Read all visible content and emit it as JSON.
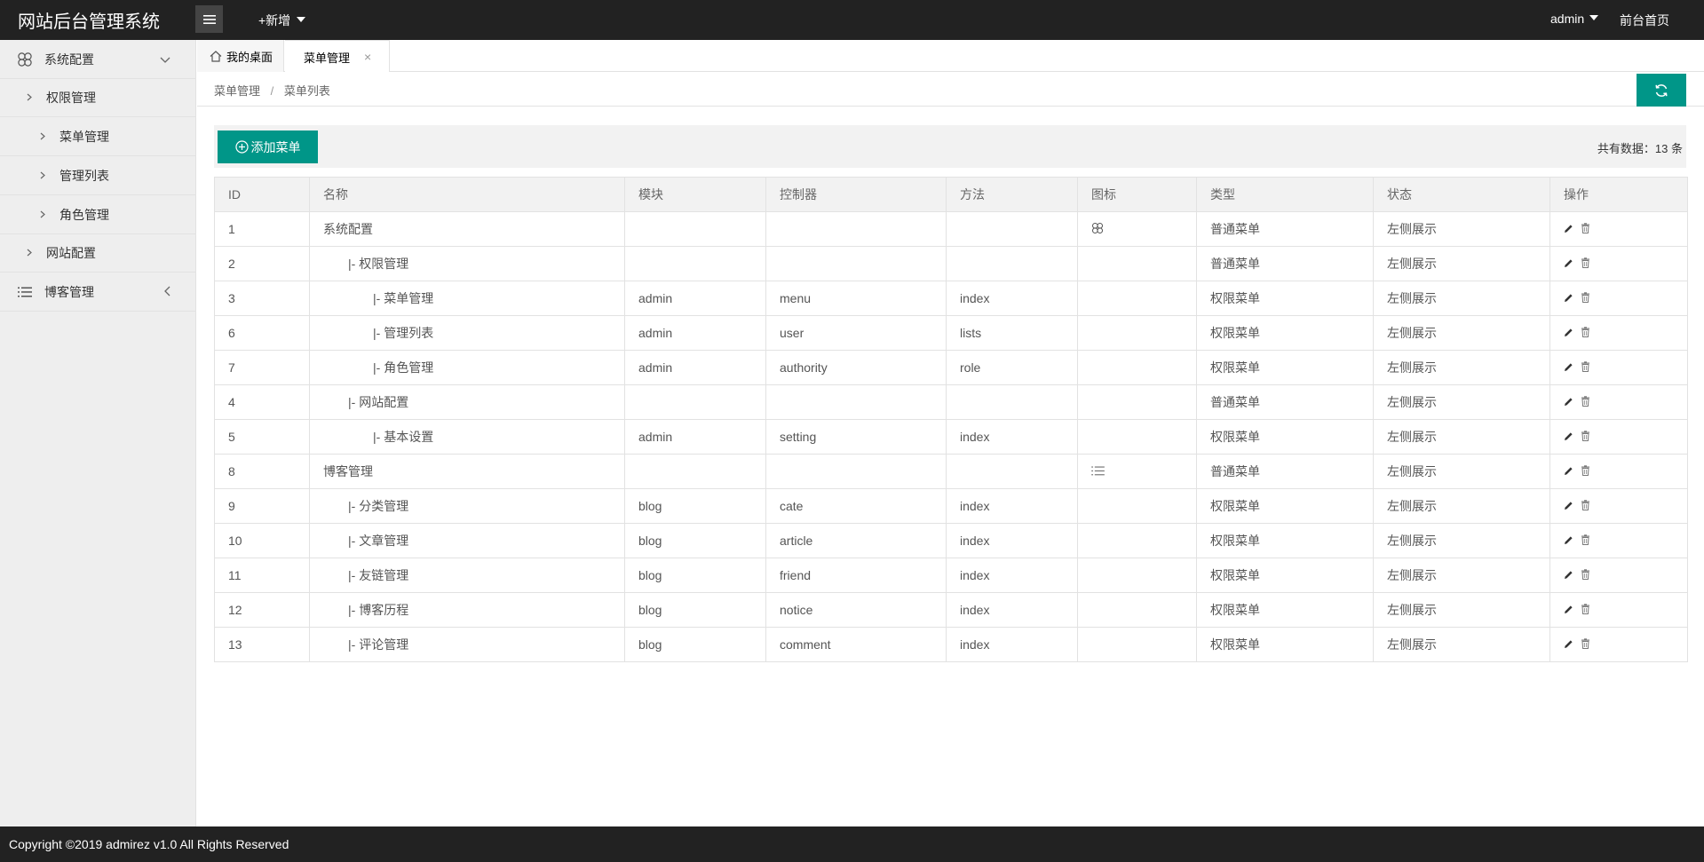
{
  "header": {
    "title": "网站后台管理系统",
    "add_new": "+新增",
    "user": "admin",
    "front_home": "前台首页"
  },
  "sidebar": {
    "items": [
      {
        "label": "系统配置",
        "level": 1,
        "icon": "flower-icon"
      },
      {
        "label": "权限管理",
        "level": 2
      },
      {
        "label": "菜单管理",
        "level": 3
      },
      {
        "label": "管理列表",
        "level": 3
      },
      {
        "label": "角色管理",
        "level": 3
      },
      {
        "label": "网站配置",
        "level": 2
      },
      {
        "label": "博客管理",
        "level": 1,
        "icon": "list-icon"
      }
    ]
  },
  "tabs": [
    {
      "label": "我的桌面"
    },
    {
      "label": "菜单管理",
      "close": "×"
    }
  ],
  "breadcrumb": {
    "items": [
      "菜单管理",
      "菜单列表"
    ],
    "separator": "/"
  },
  "toolbar": {
    "add_label": "添加菜单",
    "total": "共有数据：13 条"
  },
  "table": {
    "headers": [
      "ID",
      "名称",
      "模块",
      "控制器",
      "方法",
      "图标",
      "类型",
      "状态",
      "操作"
    ],
    "rows": [
      {
        "id": "1",
        "name": "系统配置",
        "indent": 0,
        "module": "",
        "controller": "",
        "method": "",
        "icon": "flower-icon",
        "type": "普通菜单",
        "status": "左侧展示"
      },
      {
        "id": "2",
        "name": "|- 权限管理",
        "indent": 1,
        "module": "",
        "controller": "",
        "method": "",
        "icon": "",
        "type": "普通菜单",
        "status": "左侧展示"
      },
      {
        "id": "3",
        "name": "|- 菜单管理",
        "indent": 2,
        "module": "admin",
        "controller": "menu",
        "method": "index",
        "icon": "",
        "type": "权限菜单",
        "status": "左侧展示"
      },
      {
        "id": "6",
        "name": "|- 管理列表",
        "indent": 2,
        "module": "admin",
        "controller": "user",
        "method": "lists",
        "icon": "",
        "type": "权限菜单",
        "status": "左侧展示"
      },
      {
        "id": "7",
        "name": "|- 角色管理",
        "indent": 2,
        "module": "admin",
        "controller": "authority",
        "method": "role",
        "icon": "",
        "type": "权限菜单",
        "status": "左侧展示"
      },
      {
        "id": "4",
        "name": "|- 网站配置",
        "indent": 1,
        "module": "",
        "controller": "",
        "method": "",
        "icon": "",
        "type": "普通菜单",
        "status": "左侧展示"
      },
      {
        "id": "5",
        "name": "|- 基本设置",
        "indent": 2,
        "module": "admin",
        "controller": "setting",
        "method": "index",
        "icon": "",
        "type": "权限菜单",
        "status": "左侧展示"
      },
      {
        "id": "8",
        "name": "博客管理",
        "indent": 0,
        "module": "",
        "controller": "",
        "method": "",
        "icon": "list-icon",
        "type": "普通菜单",
        "status": "左侧展示"
      },
      {
        "id": "9",
        "name": "|- 分类管理",
        "indent": 1,
        "module": "blog",
        "controller": "cate",
        "method": "index",
        "icon": "",
        "type": "权限菜单",
        "status": "左侧展示"
      },
      {
        "id": "10",
        "name": "|- 文章管理",
        "indent": 1,
        "module": "blog",
        "controller": "article",
        "method": "index",
        "icon": "",
        "type": "权限菜单",
        "status": "左侧展示"
      },
      {
        "id": "11",
        "name": "|- 友链管理",
        "indent": 1,
        "module": "blog",
        "controller": "friend",
        "method": "index",
        "icon": "",
        "type": "权限菜单",
        "status": "左侧展示"
      },
      {
        "id": "12",
        "name": "|- 博客历程",
        "indent": 1,
        "module": "blog",
        "controller": "notice",
        "method": "index",
        "icon": "",
        "type": "权限菜单",
        "status": "左侧展示"
      },
      {
        "id": "13",
        "name": "|- 评论管理",
        "indent": 1,
        "module": "blog",
        "controller": "comment",
        "method": "index",
        "icon": "",
        "type": "权限菜单",
        "status": "左侧展示"
      }
    ]
  },
  "footer": {
    "copyright": "Copyright ©2019 admirez v1.0 All Rights Reserved"
  },
  "colors": {
    "header_bg": "#222222",
    "accent": "#009688",
    "sidebar_bg": "#eeeeee"
  }
}
